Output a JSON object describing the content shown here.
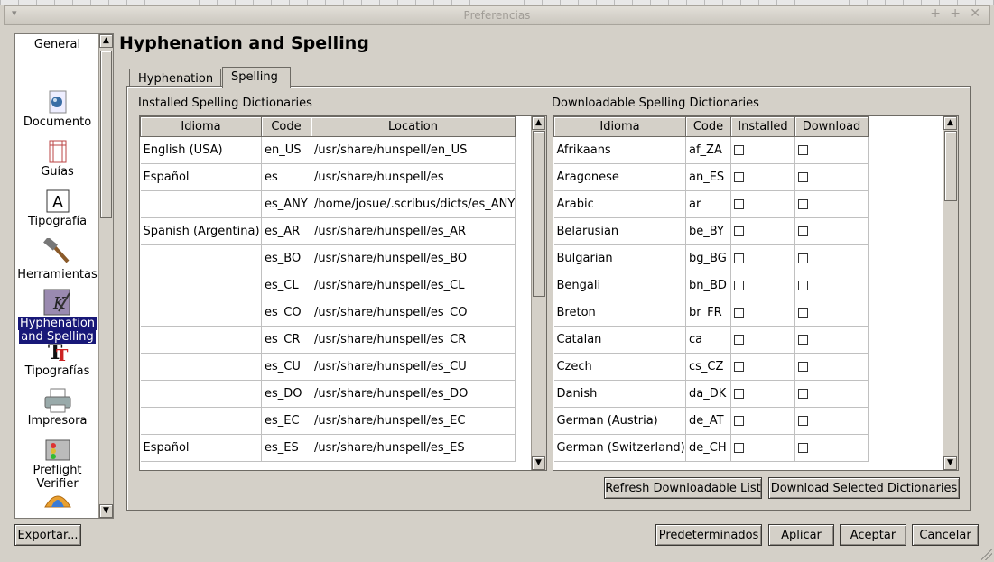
{
  "window": {
    "title": "Preferencias"
  },
  "sidebar": {
    "items": [
      {
        "label": "General",
        "icon": "general-icon"
      },
      {
        "label": "Documento",
        "icon": "document-icon"
      },
      {
        "label": "Guías",
        "icon": "guides-icon"
      },
      {
        "label": "Tipografía",
        "icon": "typography-icon"
      },
      {
        "label": "Herramientas",
        "icon": "tools-hammer-icon"
      },
      {
        "label": "Hyphenation",
        "label2": "and Spelling",
        "icon": "hyphenation-icon",
        "active": true
      },
      {
        "label": "Tipografías",
        "icon": "fonts-icon"
      },
      {
        "label": "Impresora",
        "icon": "printer-icon"
      },
      {
        "label": "Preflight",
        "label2": "Verifier",
        "icon": "preflight-icon"
      },
      {
        "label": "",
        "icon": "umbrella-icon"
      }
    ]
  },
  "page": {
    "title": "Hyphenation and Spelling"
  },
  "tabs": [
    {
      "label": "Hyphenation"
    },
    {
      "label": "Spelling",
      "active": true
    }
  ],
  "installed": {
    "title": "Installed Spelling Dictionaries",
    "columns": [
      "Idioma",
      "Code",
      "Location"
    ],
    "rows": [
      [
        "English (USA)",
        "en_US",
        "/usr/share/hunspell/en_US"
      ],
      [
        "Español",
        "es",
        "/usr/share/hunspell/es"
      ],
      [
        "",
        "es_ANY",
        "/home/josue/.scribus/dicts/es_ANY"
      ],
      [
        "Spanish (Argentina)",
        "es_AR",
        "/usr/share/hunspell/es_AR"
      ],
      [
        "",
        "es_BO",
        "/usr/share/hunspell/es_BO"
      ],
      [
        "",
        "es_CL",
        "/usr/share/hunspell/es_CL"
      ],
      [
        "",
        "es_CO",
        "/usr/share/hunspell/es_CO"
      ],
      [
        "",
        "es_CR",
        "/usr/share/hunspell/es_CR"
      ],
      [
        "",
        "es_CU",
        "/usr/share/hunspell/es_CU"
      ],
      [
        "",
        "es_DO",
        "/usr/share/hunspell/es_DO"
      ],
      [
        "",
        "es_EC",
        "/usr/share/hunspell/es_EC"
      ],
      [
        "Español",
        "es_ES",
        "/usr/share/hunspell/es_ES"
      ]
    ]
  },
  "downloadable": {
    "title": "Downloadable Spelling Dictionaries",
    "columns": [
      "Idioma",
      "Code",
      "Installed",
      "Download"
    ],
    "rows": [
      [
        "Afrikaans",
        "af_ZA"
      ],
      [
        "Aragonese",
        "an_ES"
      ],
      [
        "Arabic",
        "ar"
      ],
      [
        "Belarusian",
        "be_BY"
      ],
      [
        "Bulgarian",
        "bg_BG"
      ],
      [
        "Bengali",
        "bn_BD"
      ],
      [
        "Breton",
        "br_FR"
      ],
      [
        "Catalan",
        "ca"
      ],
      [
        "Czech",
        "cs_CZ"
      ],
      [
        "Danish",
        "da_DK"
      ],
      [
        "German (Austria)",
        "de_AT"
      ],
      [
        "German (Switzerland)",
        "de_CH"
      ]
    ]
  },
  "buttons": {
    "refresh": "Refresh Downloadable List",
    "download_selected": "Download Selected Dictionaries",
    "export": "Exportar...",
    "defaults": "Predeterminados",
    "apply": "Aplicar",
    "accept": "Aceptar",
    "cancel": "Cancelar"
  }
}
